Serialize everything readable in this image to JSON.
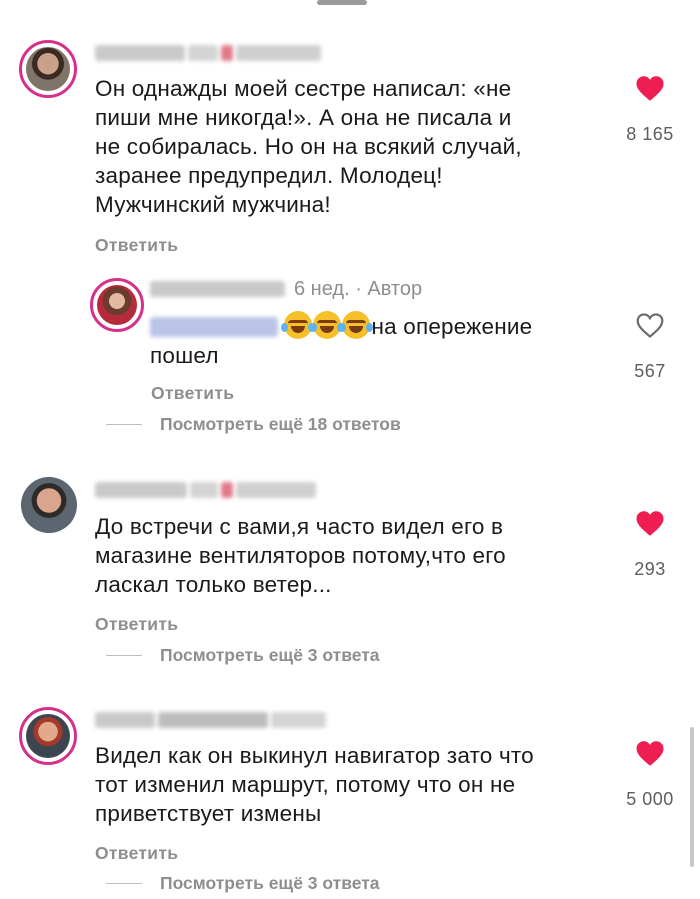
{
  "comments": [
    {
      "text_lines": [
        "Он однажды моей сестре написал: «не",
        "пиши мне никогда!». А она не писала и",
        "не собиралась. Но он на всякий случай,",
        "заранее предупредил. Молодец!",
        "Мужчинский мужчина!"
      ],
      "likes": "8 165",
      "reply_label": "Ответить",
      "liked": true
    },
    {
      "meta": "6 нед. · Автор",
      "text_suffix": "на опережение",
      "text_line2": "пошел",
      "likes": "567",
      "reply_label": "Ответить",
      "more_label": "Посмотреть ещё 18 ответов",
      "liked": false
    },
    {
      "text_lines": [
        "До встречи с вами,я часто видел его в",
        "магазине вентиляторов потому,что его",
        "ласкал только ветер..."
      ],
      "likes": "293",
      "reply_label": "Ответить",
      "more_label": "Посмотреть ещё 3 ответа",
      "liked": true
    },
    {
      "text_lines": [
        "Видел как он выкинул навигатор зато что",
        "тот изменил маршрут, потому что он не",
        "приветствует измены"
      ],
      "likes": "5 000",
      "reply_label": "Ответить",
      "more_label": "Посмотреть ещё 3 ответа",
      "liked": true
    }
  ],
  "icons": {
    "liked_heart": "heart-filled-icon",
    "unliked_heart": "heart-outline-icon",
    "emoji": "face-with-tears-of-joy"
  },
  "colors": {
    "heart": "#ee1d52",
    "muted_text": "#8e8e8e",
    "story_ring": "#d6308a"
  }
}
